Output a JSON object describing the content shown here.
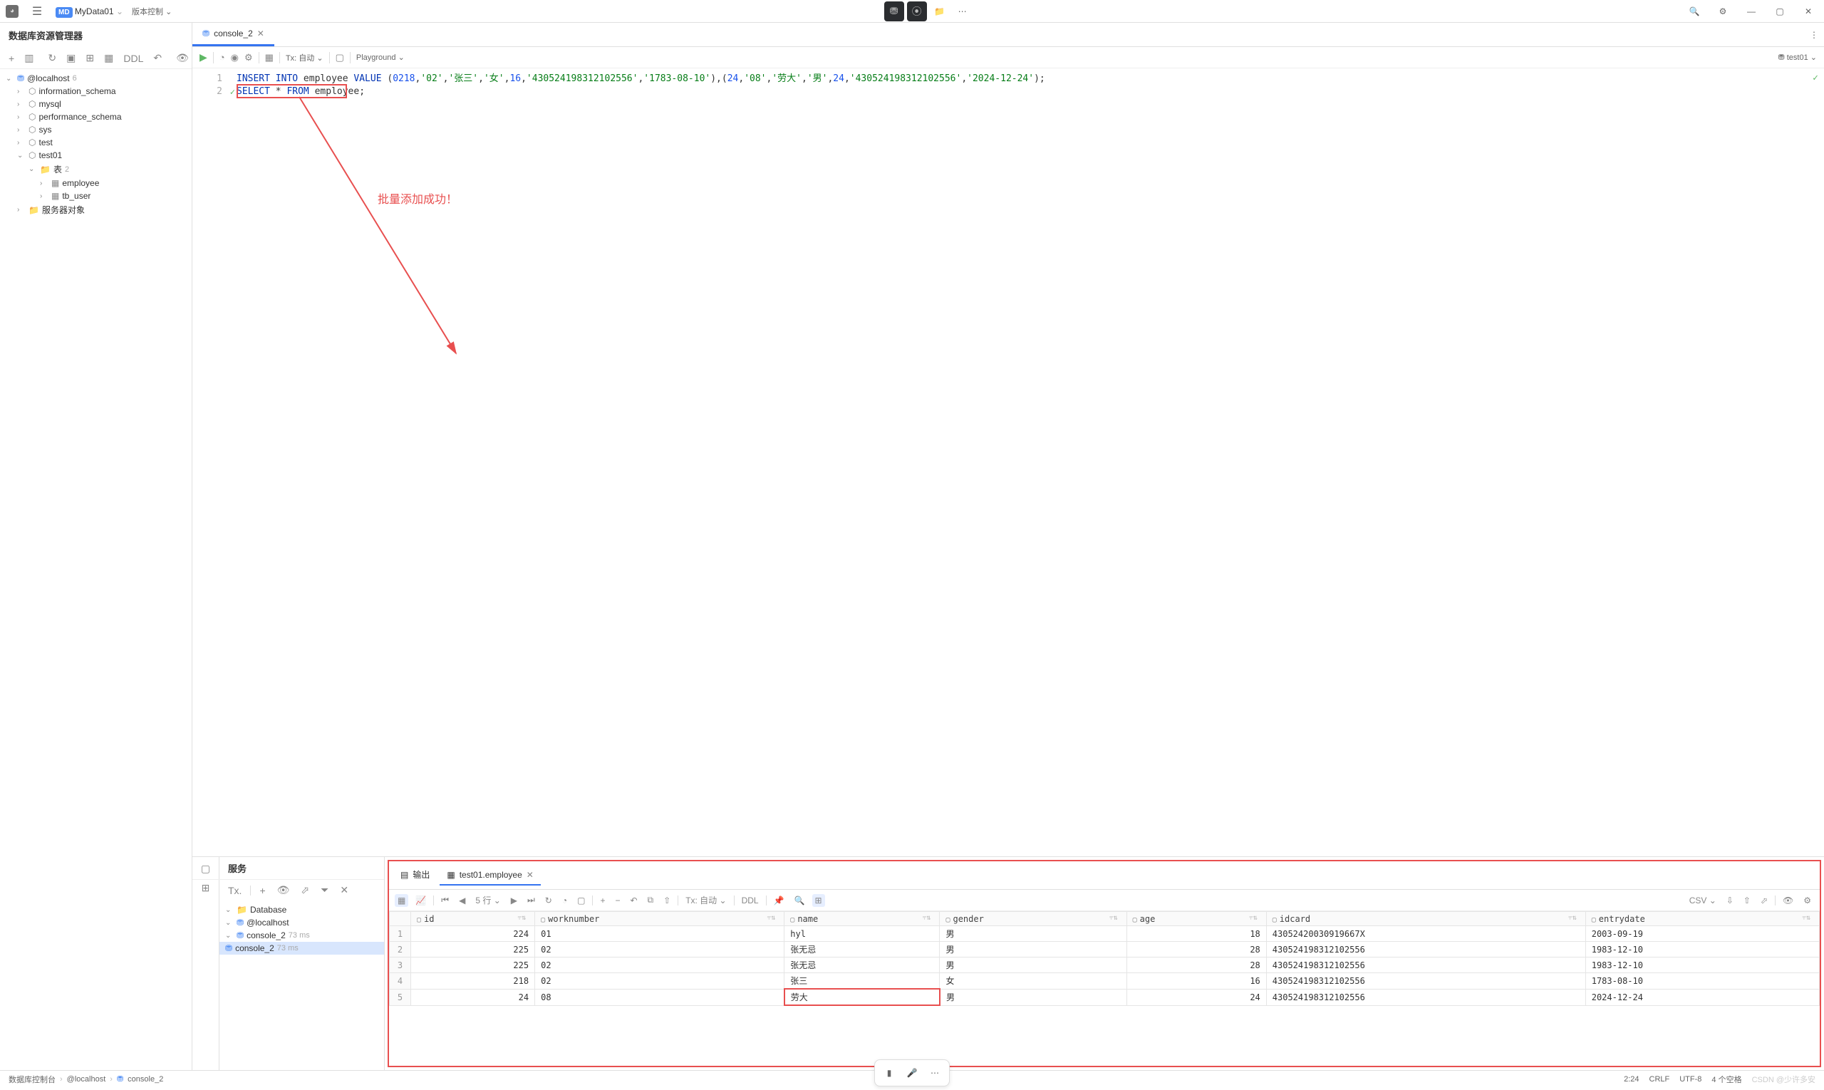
{
  "titlebar": {
    "project_badge": "MD",
    "project_name": "MyData01",
    "vcs_label": "版本控制"
  },
  "sidebar": {
    "title": "数据库资源管理器",
    "toolbar": {
      "ddl": "DDL"
    },
    "root": "@localhost",
    "root_count": "6",
    "schemas": [
      "information_schema",
      "mysql",
      "performance_schema",
      "sys",
      "test",
      "test01"
    ],
    "tables_label": "表",
    "tables_count": "2",
    "tables": [
      "employee",
      "tb_user"
    ],
    "server_objects": "服务器对象"
  },
  "editor": {
    "tab_name": "console_2",
    "tx_label": "Tx: 自动",
    "playground": "Playground",
    "test_label": "test01",
    "code_lines": [
      {
        "n": "1",
        "html": "<span class='kw'>INSERT</span> <span class='kw'>INTO</span> employee <span class='kw'>VALUE</span> (<span class='num'>0218</span>,<span class='str'>'02'</span>,<span class='str'>'张三'</span>,<span class='str'>'女'</span>,<span class='num'>16</span>,<span class='str'>'430524198312102556'</span>,<span class='str'>'1783-08-10'</span>),(<span class='num'>24</span>,<span class='str'>'08'</span>,<span class='str'>'劳大'</span>,<span class='str'>'男'</span>,<span class='num'>24</span>,<span class='str'>'430524198312102556'</span>,<span class='str'>'2024-12-24'</span>);"
      },
      {
        "n": "2",
        "html": "<span class='kw'>SELECT</span> * <span class='kw'>FROM</span> employee;",
        "check": true
      }
    ],
    "annotation": "批量添加成功！"
  },
  "services": {
    "title": "服务",
    "tx_short": "Tx.",
    "tree": {
      "database": "Database",
      "localhost": "@localhost",
      "console": "console_2",
      "time": "73 ms"
    }
  },
  "results": {
    "output_tab": "输出",
    "table_tab": "test01.employee",
    "rows_label": "5 行",
    "tx_label": "Tx: 自动",
    "ddl": "DDL",
    "csv": "CSV",
    "columns": [
      "id",
      "worknumber",
      "name",
      "gender",
      "age",
      "idcard",
      "entrydate"
    ],
    "rows": [
      {
        "n": "1",
        "id": "224",
        "worknumber": "01",
        "name": "hyl",
        "gender": "男",
        "age": "18",
        "idcard": "43052420030919667X",
        "entrydate": "2003-09-19"
      },
      {
        "n": "2",
        "id": "225",
        "worknumber": "02",
        "name": "张无忌",
        "gender": "男",
        "age": "28",
        "idcard": "430524198312102556",
        "entrydate": "1983-12-10"
      },
      {
        "n": "3",
        "id": "225",
        "worknumber": "02",
        "name": "张无忌",
        "gender": "男",
        "age": "28",
        "idcard": "430524198312102556",
        "entrydate": "1983-12-10"
      },
      {
        "n": "4",
        "id": "218",
        "worknumber": "02",
        "name": "张三",
        "gender": "女",
        "age": "16",
        "idcard": "430524198312102556",
        "entrydate": "1783-08-10"
      },
      {
        "n": "5",
        "id": "24",
        "worknumber": "08",
        "name": "劳大",
        "gender": "男",
        "age": "24",
        "idcard": "430524198312102556",
        "entrydate": "2024-12-24"
      }
    ]
  },
  "statusbar": {
    "bc1": "数据库控制台",
    "bc2": "@localhost",
    "bc3": "console_2",
    "pos": "2:24",
    "crlf": "CRLF",
    "enc": "UTF-8",
    "indent": "4 个空格",
    "watermark": "CSDN @少许多安"
  }
}
